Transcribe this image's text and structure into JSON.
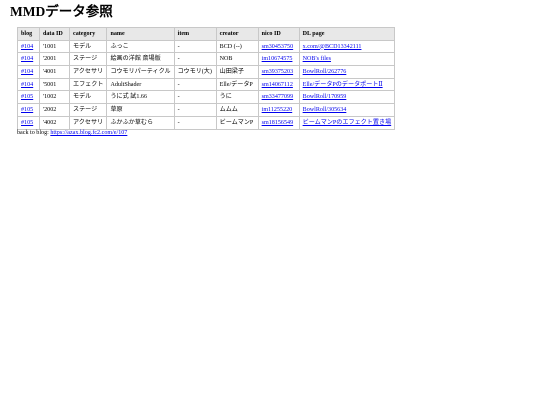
{
  "page_title": "MMDデータ参照",
  "table": {
    "headers": [
      "blog",
      "data ID",
      "category",
      "name",
      "item",
      "creator",
      "nico ID",
      "DL page"
    ],
    "rows": [
      {
        "blog": "#104",
        "data_id": "'1001",
        "category": "モデル",
        "name": "ふっこ",
        "item": "-",
        "creator": "BCD (--)",
        "nico_id": "sm30453750",
        "dl_page": "x.com/@BCD13342111"
      },
      {
        "blog": "#104",
        "data_id": "'2001",
        "category": "ステージ",
        "name": "絵画の洋館 斎場版",
        "item": "-",
        "creator": "NOB",
        "nico_id": "im10674575",
        "dl_page": "NOB's files"
      },
      {
        "blog": "#104",
        "data_id": "'4001",
        "category": "アクセサリ",
        "name": "コウモリパーティクル",
        "item": "コウモリ(大)",
        "creator": "山田梁子",
        "nico_id": "sm39375203",
        "dl_page": "BowlRoll/262776"
      },
      {
        "blog": "#104",
        "data_id": "'5001",
        "category": "エフェクト",
        "name": "AdultShader",
        "item": "-",
        "creator": "Elle/データP",
        "nico_id": "sm14067112",
        "dl_page": "Elle/データPのデータポートⅡ"
      },
      {
        "blog": "#105",
        "data_id": "'1002",
        "category": "モデル",
        "name": "うに式 試1.66",
        "item": "-",
        "creator": "うに",
        "nico_id": "sm33477099",
        "dl_page": "BowlRoll/170959"
      },
      {
        "blog": "#105",
        "data_id": "'2002",
        "category": "ステージ",
        "name": "草原",
        "item": "-",
        "creator": "ムムム",
        "nico_id": "im11255220",
        "dl_page": "BowlRoll/305634"
      },
      {
        "blog": "#105",
        "data_id": "'4002",
        "category": "アクセサリ",
        "name": "ふかふか草むら",
        "item": "-",
        "creator": "ビームマンP",
        "nico_id": "sm18156549",
        "dl_page": "ビームマンPのエフェクト置き場"
      }
    ]
  },
  "footer": {
    "label": "back to blog: ",
    "link_text": "https://azax.blog.fc2.com/e/107"
  },
  "colors": {
    "link": "#0000ee",
    "header_bg": "#e8e8e8",
    "border": "#c8c8c8"
  }
}
